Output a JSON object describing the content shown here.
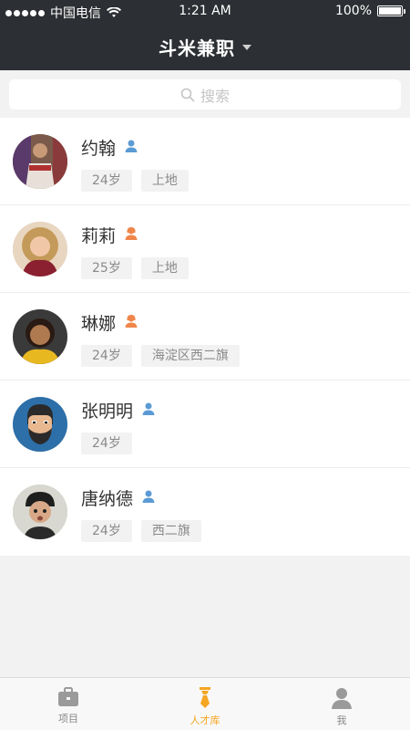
{
  "status_bar": {
    "carrier": "中国电信",
    "time": "1:21 AM",
    "battery": "100%"
  },
  "nav": {
    "title": "斗米兼职"
  },
  "search": {
    "placeholder": "搜索"
  },
  "people": [
    {
      "name": "约翰",
      "gender": "male",
      "tags": [
        "24岁",
        "上地"
      ]
    },
    {
      "name": "莉莉",
      "gender": "female",
      "tags": [
        "25岁",
        "上地"
      ]
    },
    {
      "name": "琳娜",
      "gender": "female",
      "tags": [
        "24岁",
        "海淀区西二旗"
      ]
    },
    {
      "name": "张明明",
      "gender": "male",
      "tags": [
        "24岁"
      ]
    },
    {
      "name": "唐纳德",
      "gender": "male",
      "tags": [
        "24岁",
        "西二旗"
      ]
    }
  ],
  "tabs": [
    {
      "label": "项目",
      "icon": "briefcase-icon",
      "active": false
    },
    {
      "label": "人才库",
      "icon": "tie-icon",
      "active": true
    },
    {
      "label": "我",
      "icon": "person-icon",
      "active": false
    }
  ],
  "colors": {
    "header_bg": "#2c2f33",
    "accent": "#f5a623",
    "male": "#5b9bd5",
    "female": "#f0854a"
  }
}
